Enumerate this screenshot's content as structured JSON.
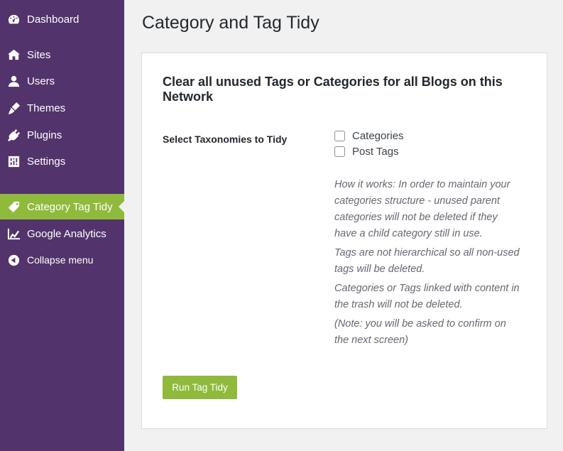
{
  "sidebar": {
    "items": [
      {
        "label": "Dashboard",
        "icon": "dashboard-icon"
      },
      {
        "label": "Sites",
        "icon": "sites-icon"
      },
      {
        "label": "Users",
        "icon": "users-icon"
      },
      {
        "label": "Themes",
        "icon": "themes-icon"
      },
      {
        "label": "Plugins",
        "icon": "plugins-icon"
      },
      {
        "label": "Settings",
        "icon": "settings-icon"
      },
      {
        "label": "Category Tag Tidy",
        "icon": "tag-icon",
        "active": true
      },
      {
        "label": "Google Analytics",
        "icon": "analytics-icon"
      },
      {
        "label": "Collapse menu",
        "icon": "collapse-icon"
      }
    ]
  },
  "page": {
    "title": "Category and Tag Tidy"
  },
  "panel": {
    "heading": "Clear all unused Tags or Categories for all Blogs on this Network",
    "field_label": "Select Taxonomies to Tidy",
    "options": [
      {
        "label": "Categories",
        "checked": false
      },
      {
        "label": "Post Tags",
        "checked": false
      }
    ],
    "help": [
      "How it works: In order to maintain your categories structure - unused parent categories will not be deleted if they have a child category still in use.",
      "Tags are not hierarchical so all non-used tags will be deleted.",
      "Categories or Tags linked with content in the trash will not be deleted.",
      "(Note: you will be asked to confirm on the next screen)"
    ],
    "button": "Run Tag Tidy"
  },
  "colors": {
    "sidebar_bg": "#52336b",
    "accent": "#8fba3c",
    "page_bg": "#f1f1f1"
  }
}
